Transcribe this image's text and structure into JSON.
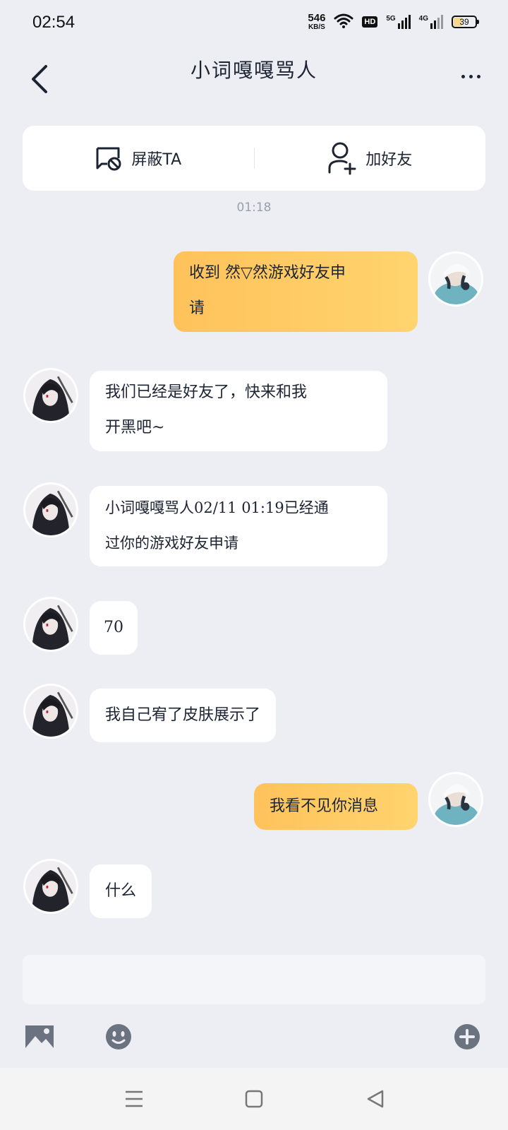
{
  "status_bar": {
    "time": "02:54",
    "net_speed": "546",
    "net_unit": "KB/S",
    "hd_label": "HD",
    "signal1_label": "5G",
    "signal2_label": "4G",
    "battery": "39",
    "battery_level": 0.39,
    "icons": [
      "wifi-icon",
      "signal-5g-icon",
      "signal-4g-icon",
      "battery-icon"
    ]
  },
  "header": {
    "title": "小词嘎嘎骂人",
    "back_icon": "chevron-left-icon",
    "more_icon": "more-dots-icon"
  },
  "actions": {
    "block_label": "屏蔽TA",
    "block_icon": "block-chat-icon",
    "add_friend_label": "加好友",
    "add_friend_icon": "add-user-icon"
  },
  "timestamp": "01:18",
  "messages": [
    {
      "side": "out",
      "line1": "收到 然▽然游戏好友申",
      "line2": "请"
    },
    {
      "side": "in",
      "line1": "我们已经是好友了，快来和我",
      "line2": "开黑吧~"
    },
    {
      "side": "in",
      "line1": "小词嘎嘎骂人02/11 01:19已经通",
      "line2": "过你的游戏好友申请"
    },
    {
      "side": "in",
      "text": "70"
    },
    {
      "side": "in",
      "text": "我自己宥了皮肤展示了"
    },
    {
      "side": "out",
      "text": "我看不见你消息"
    },
    {
      "side": "in",
      "text": "什么"
    }
  ],
  "input": {
    "placeholder": ""
  },
  "toolbar": {
    "image_icon": "image-icon",
    "emoji_icon": "emoji-icon",
    "plus_icon": "plus-circle-icon"
  },
  "nav": {
    "menu_icon": "menu-icon",
    "home_icon": "home-square-icon",
    "back_icon": "back-triangle-icon"
  },
  "colors": {
    "background": "#eceef3",
    "bubble_out": "#ffc864",
    "bubble_in": "#ffffff"
  }
}
